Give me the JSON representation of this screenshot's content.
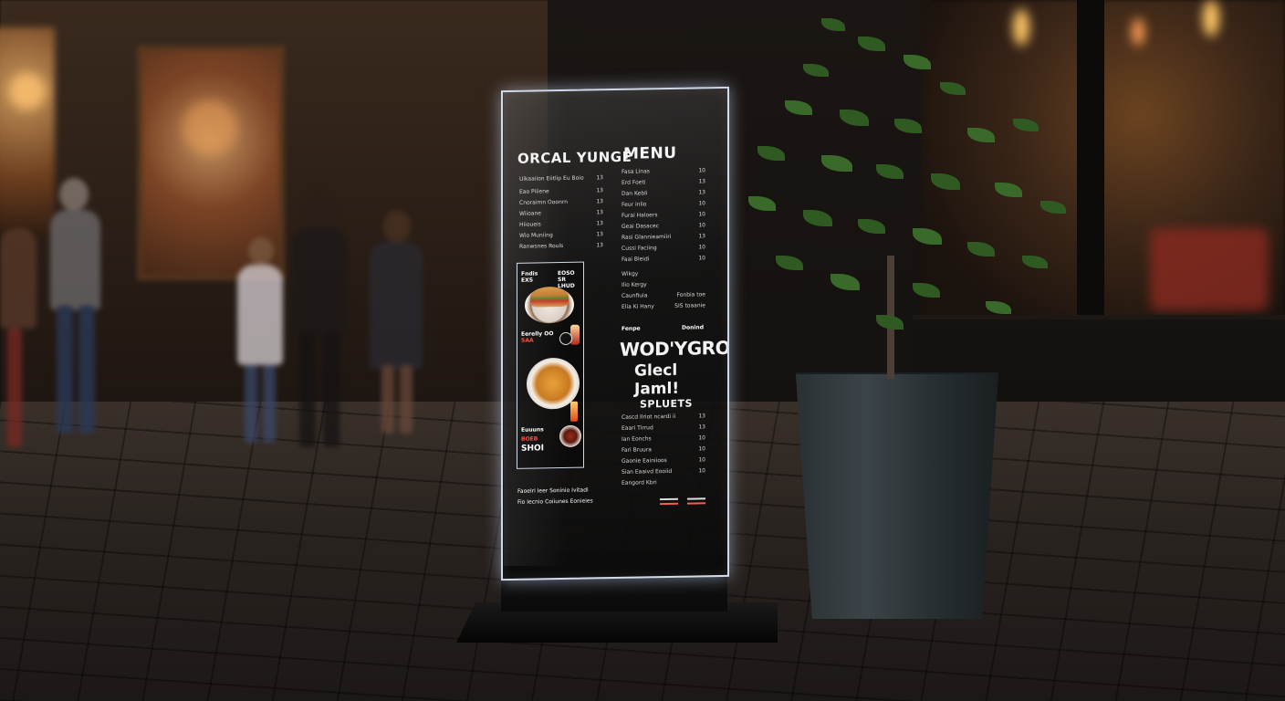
{
  "sign": {
    "brand_title": "ORCAL YUNGE",
    "menu_title": "MENU",
    "left_items": [
      {
        "label": "Uikaaiion Eiitlip Eu Boio",
        "price": "13"
      },
      {
        "label": "Eao Piiiene",
        "price": "13"
      },
      {
        "label": "Cnoraimn Ooonrn",
        "price": "13"
      },
      {
        "label": "Wiioane",
        "price": "13"
      },
      {
        "label": "Hiioueis",
        "price": "13"
      },
      {
        "label": "Wio Muniing",
        "price": "13"
      },
      {
        "label": "Ranwsnes Rouls",
        "price": "13"
      }
    ],
    "right_items": [
      {
        "label": "Fasa Linas",
        "price": "10"
      },
      {
        "label": "Erd Foeti",
        "price": "13"
      },
      {
        "label": "Dan Kebli",
        "price": "13"
      },
      {
        "label": "Feur inlio",
        "price": "10"
      },
      {
        "label": "Furai Haloers",
        "price": "10"
      },
      {
        "label": "Geai Dasacec",
        "price": "10"
      },
      {
        "label": "Rasi Glannieamiiri",
        "price": "13"
      },
      {
        "label": "Cussi Faciing",
        "price": "10"
      },
      {
        "label": "Faai Bleidi",
        "price": "10"
      }
    ],
    "feature": {
      "top_left": "Fndis EXS",
      "top_right": "EOSO SR LHUD",
      "mid": "Eerelly OO",
      "mid_accent": "SAA",
      "bottom_left": "Euuuns",
      "bottom_accent": "BOEB",
      "bottom_big": "SHOI"
    },
    "section_b": [
      {
        "label": "Wikgy",
        "price": ""
      },
      {
        "label": "Ilio Kergy",
        "price": ""
      },
      {
        "label": "Caunfiuia",
        "price": "Fonbia toe"
      },
      {
        "label": "Elia Ki Hany",
        "price": "SIS toaanie"
      }
    ],
    "promo": {
      "left": "Fenpe",
      "right": "Donind",
      "headline": "WOD'YGRO",
      "subline": "Glecl Jaml!"
    },
    "section_c_title": "SPLUETS",
    "section_c": [
      {
        "label": "Cascd Ilriot ncardi ii",
        "price": "13"
      },
      {
        "label": "Eaari Tirrud",
        "price": "13"
      },
      {
        "label": "Ian Eonchs",
        "price": "10"
      },
      {
        "label": "Fari Bruura",
        "price": "10"
      },
      {
        "label": "Gaonie Eainiioos",
        "price": "10"
      },
      {
        "label": "Sian Eaaivd Eooiid",
        "price": "10"
      },
      {
        "label": "Eangord Kbri",
        "price": ""
      }
    ],
    "footer_line1": "Faoelri Ieer Soninio Ivitadi",
    "footer_line2": "Fio Iecnio Coiiunes Eonieies"
  },
  "colors": {
    "sign_border": "#e6f0ff",
    "accent_red": "#ff4a3a",
    "leaf_green": "#2f5a22",
    "pot": "#2f373a"
  }
}
